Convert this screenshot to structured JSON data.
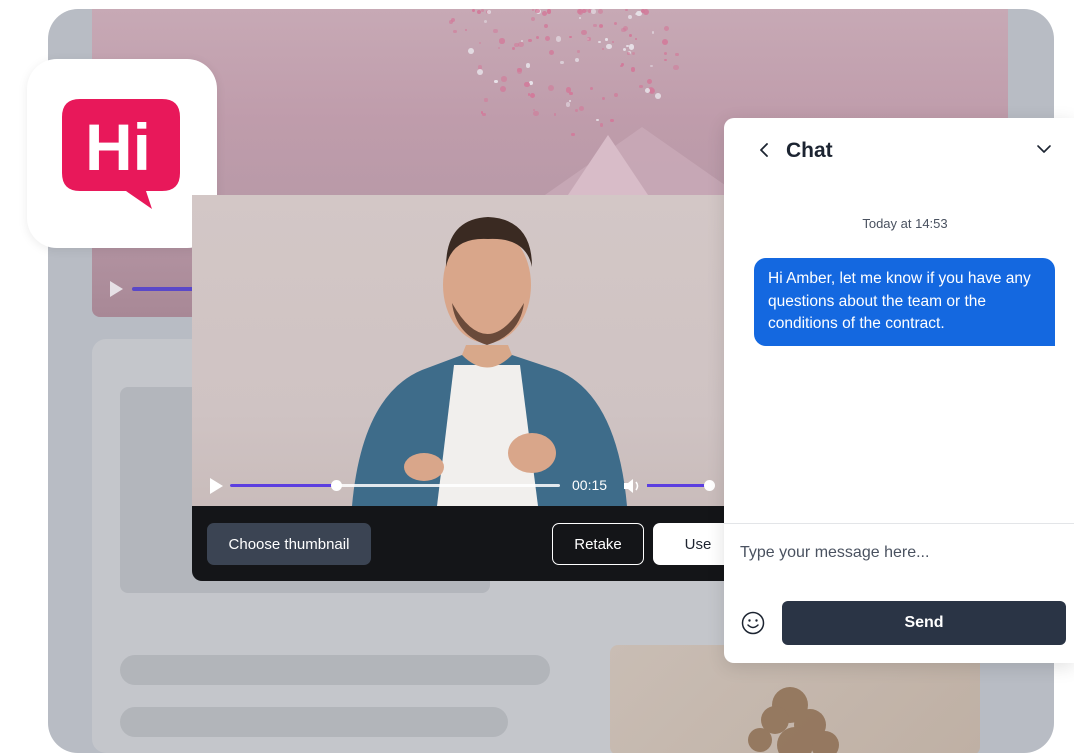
{
  "app": {
    "logo_text": "Hi",
    "brand_color": "#e8185a"
  },
  "video": {
    "time": "00:15",
    "progress": 0.32,
    "volume": 1.0,
    "accent_color": "#5b3fe0",
    "buttons": {
      "choose_thumbnail": "Choose thumbnail",
      "retake": "Retake",
      "use": "Use"
    }
  },
  "chat": {
    "title": "Chat",
    "timestamp": "Today at 14:53",
    "messages": [
      {
        "text": "Hi Amber, let me know if you have any questions about the team or the conditions of the contract.",
        "color": "#1468e0"
      }
    ],
    "input_placeholder": "Type your message here...",
    "send_label": "Send"
  },
  "icons": {
    "back": "chevron-left-icon",
    "collapse": "chevron-down-icon",
    "emoji": "smiley-icon",
    "play": "play-icon",
    "volume": "speaker-icon"
  }
}
